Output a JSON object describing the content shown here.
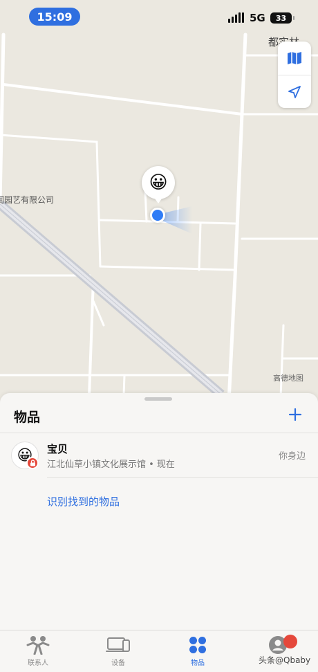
{
  "status_bar": {
    "time": "15:09",
    "network": "5G",
    "battery": "33"
  },
  "map": {
    "place_label": "润园艺有限公司",
    "corner_label": "都实林",
    "attribution": "高德地图",
    "pin_emoji": "😀",
    "controls": [
      "map-icon",
      "location-arrow-icon"
    ]
  },
  "sheet": {
    "title": "物品",
    "add_icon": "plus-icon",
    "items": [
      {
        "emoji": "😀",
        "name": "宝贝",
        "subtitle": "江北仙草小镇文化展示馆 • 现在",
        "status": "你身边",
        "badge": "lock-icon"
      }
    ],
    "identify_link": "识别找到的物品"
  },
  "tabbar": {
    "tabs": [
      {
        "label": "联系人",
        "icon": "people-icon",
        "active": false
      },
      {
        "label": "设备",
        "icon": "devices-icon",
        "active": false
      },
      {
        "label": "物品",
        "icon": "items-icon",
        "active": true
      },
      {
        "label": "",
        "icon": "profile-icon",
        "active": false
      }
    ]
  },
  "watermark": "头条@Qbaby",
  "colors": {
    "accent": "#2f6fe0",
    "badge_red": "#e5483b",
    "map_bg": "#ebe8e0"
  }
}
